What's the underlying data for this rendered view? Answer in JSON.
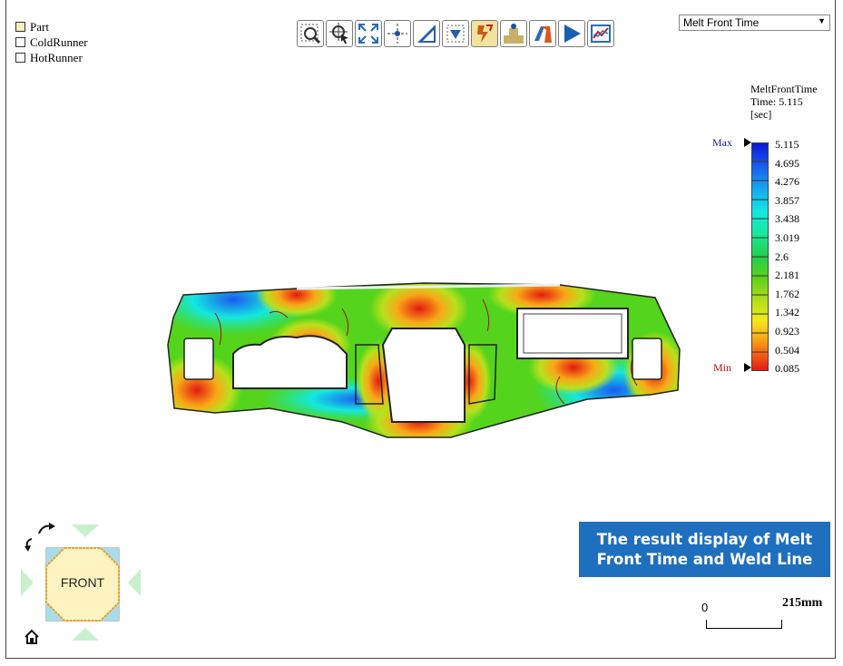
{
  "layers": [
    {
      "label": "Part",
      "checked": true
    },
    {
      "label": "ColdRunner",
      "checked": false
    },
    {
      "label": "HotRunner",
      "checked": false
    }
  ],
  "toolbar": [
    {
      "icon": "zoom-window-icon",
      "active": false
    },
    {
      "icon": "zoom-pointer-icon",
      "active": false
    },
    {
      "icon": "fit-all-icon",
      "active": false
    },
    {
      "icon": "pan-center-icon",
      "active": false
    },
    {
      "icon": "measure-icon",
      "active": false
    },
    {
      "icon": "section-cut-icon",
      "active": false
    },
    {
      "icon": "weld-line-icon",
      "active": true
    },
    {
      "icon": "xy-plot-icon",
      "active": false
    },
    {
      "icon": "shape-tool-icon",
      "active": false
    },
    {
      "icon": "play-animation-icon",
      "active": false
    },
    {
      "icon": "chart-icon",
      "active": false
    }
  ],
  "result_select": {
    "value": "Melt Front Time"
  },
  "legend": {
    "title": "MeltFrontTime",
    "time": "Time: 5.115",
    "unit": "[sec]",
    "max_label": "Max",
    "min_label": "Min",
    "values": [
      "5.115",
      "4.695",
      "4.276",
      "3.857",
      "3.438",
      "3.019",
      "2.6",
      "2.181",
      "1.762",
      "1.342",
      "0.923",
      "0.504",
      "0.085"
    ],
    "colors": {
      "max": "#0a1ad4",
      "min": "#e41a10"
    }
  },
  "navcube": {
    "face": "FRONT"
  },
  "caption": {
    "line1": "The result display of Melt",
    "line2": "Front Time and Weld Line",
    "bg": "#1f6fbf"
  },
  "scale": {
    "zero": "0",
    "length": "215mm"
  }
}
